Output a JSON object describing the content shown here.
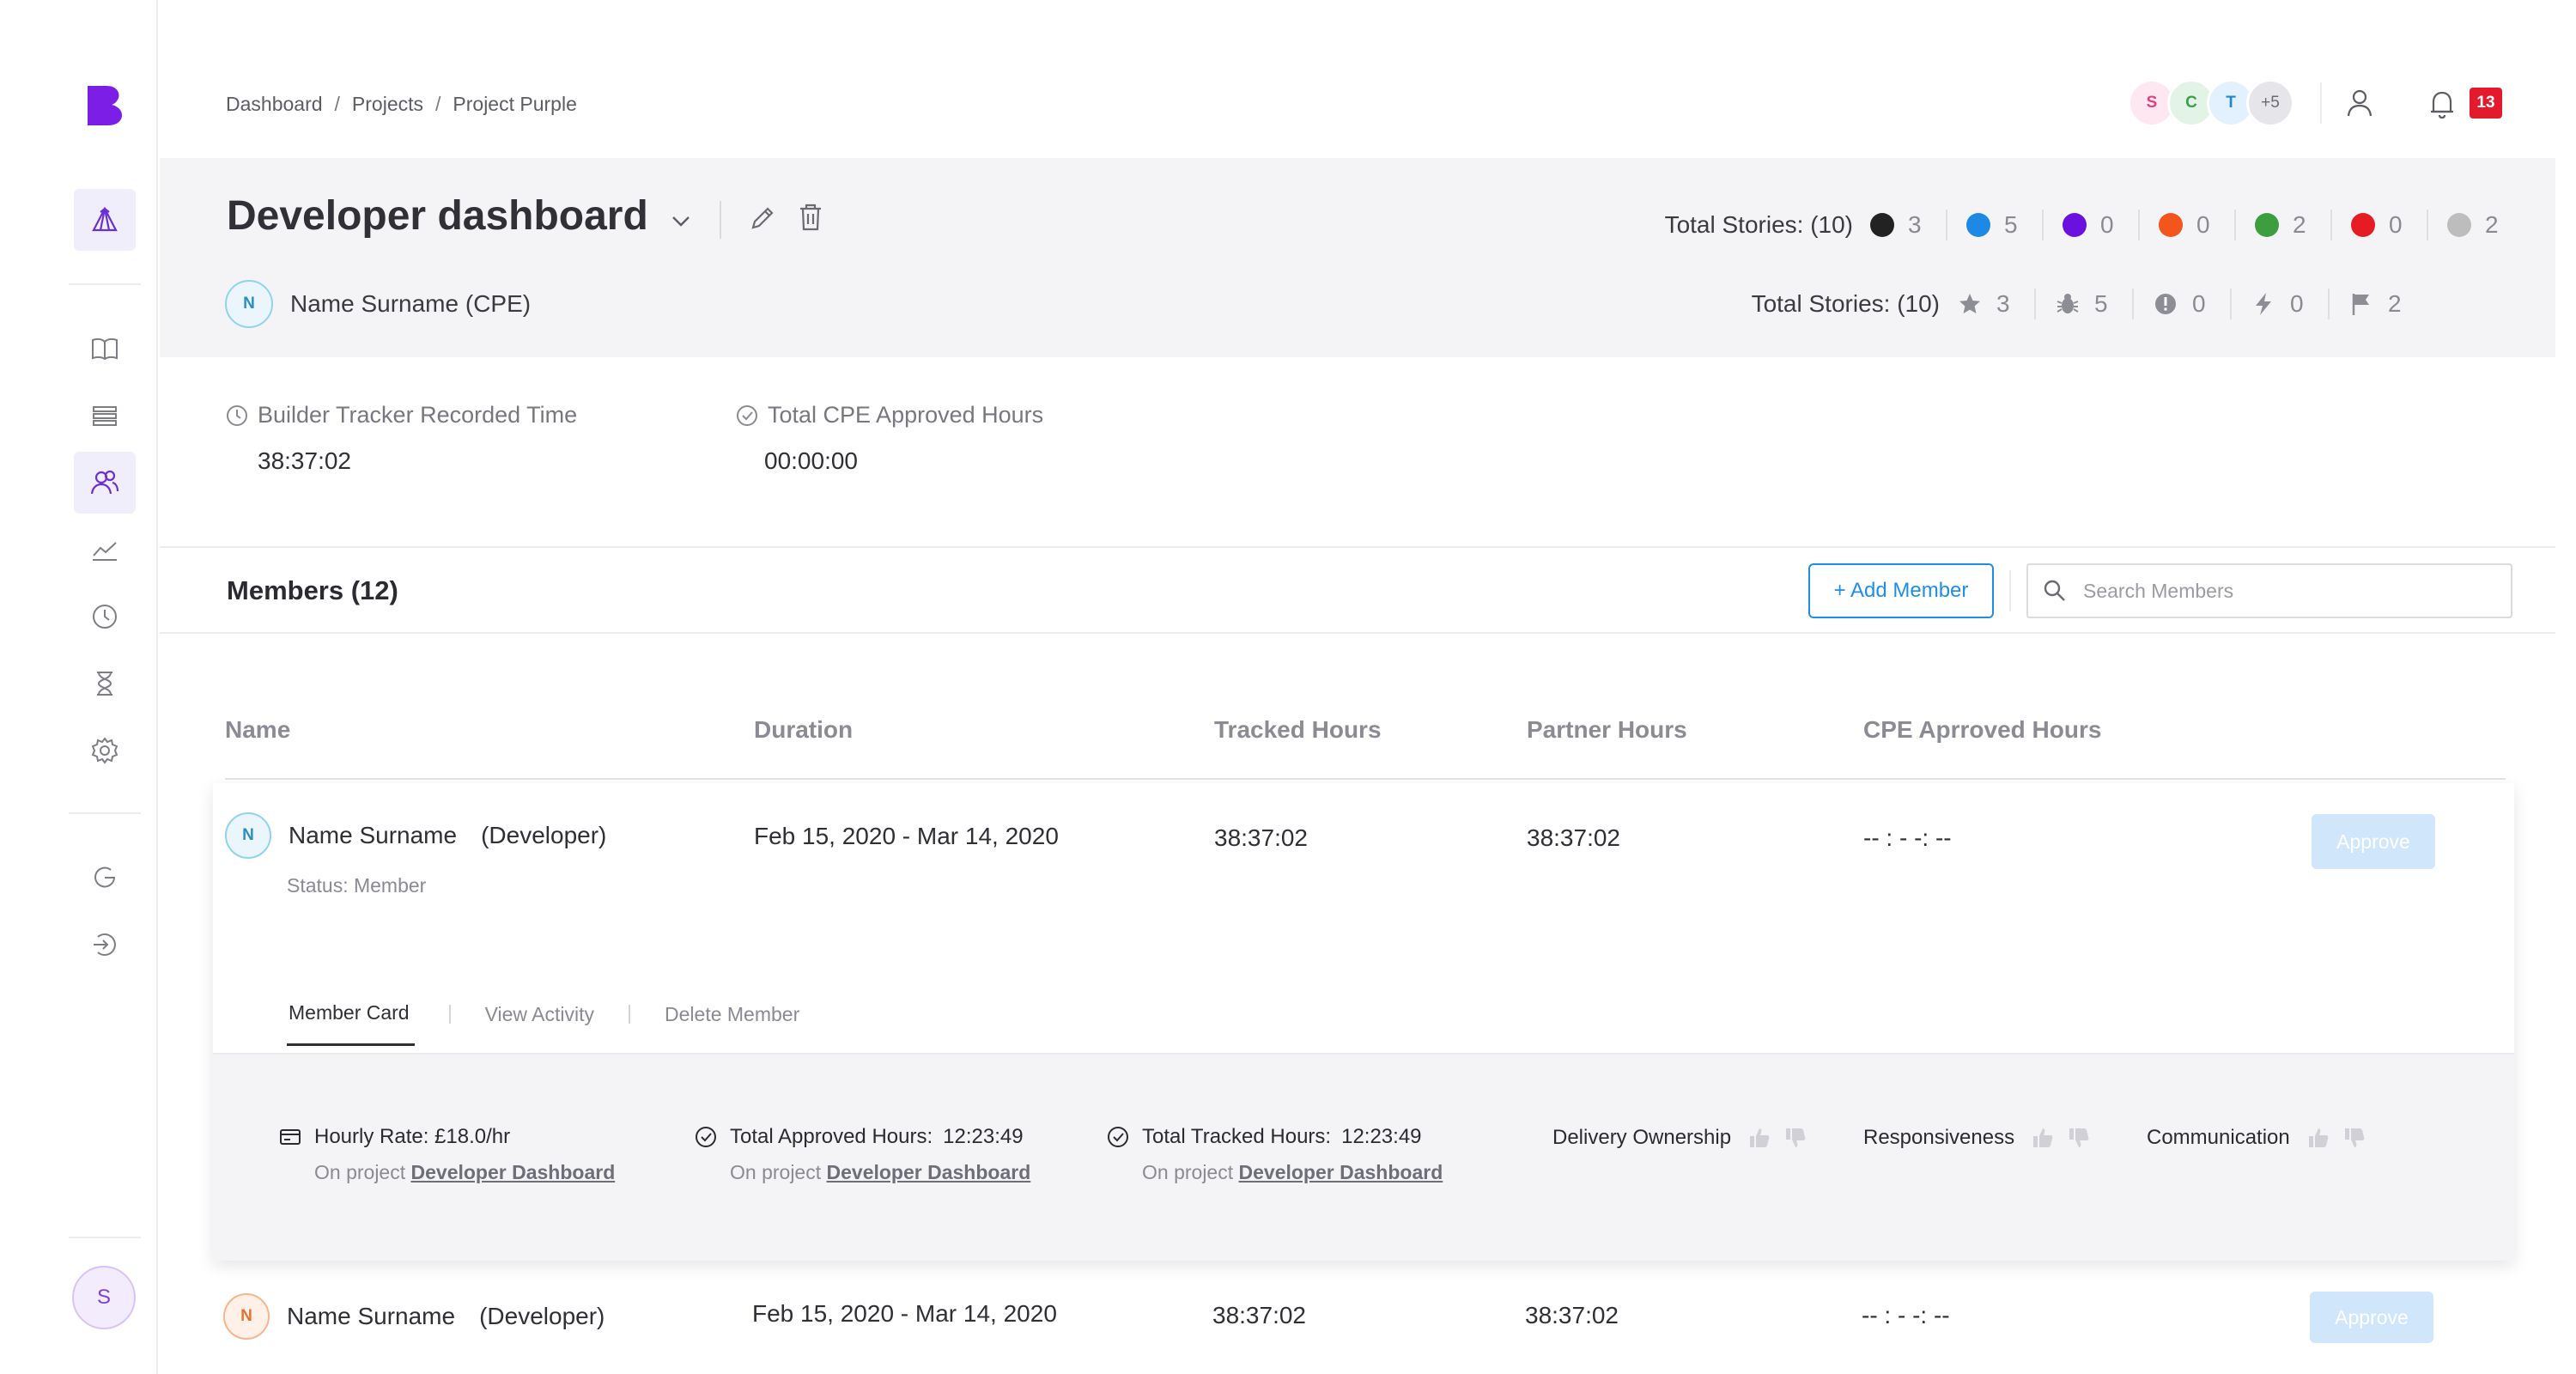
{
  "sidebar": {
    "logo": "builder-logo",
    "items": [
      {
        "icon": "tent-icon",
        "active": true
      },
      {
        "icon": "book-icon"
      },
      {
        "icon": "list-icon"
      },
      {
        "icon": "members-icon",
        "active": true
      },
      {
        "icon": "chart-icon"
      },
      {
        "icon": "clock-icon"
      },
      {
        "icon": "hourglass-icon"
      },
      {
        "icon": "gear-icon"
      },
      {
        "icon": "refresh-icon"
      },
      {
        "icon": "logout-icon"
      }
    ],
    "user_initial": "S"
  },
  "breadcrumb": [
    "Dashboard",
    "Projects",
    "Project Purple"
  ],
  "breadcrumb_sep": "/",
  "top_avatars": [
    {
      "initial": "S",
      "bg": "#fde7f1",
      "color": "#e0427f"
    },
    {
      "initial": "C",
      "bg": "#e3f4e6",
      "color": "#3aa04a"
    },
    {
      "initial": "T",
      "bg": "#e2f1fd",
      "color": "#2186d6"
    },
    {
      "initial": "+5",
      "bg": "#e6e6ea",
      "color": "#6a6a72"
    }
  ],
  "notifications": {
    "count": "13"
  },
  "header": {
    "title": "Developer dashboard",
    "owner_initial": "N",
    "owner_name": "Name Surname",
    "owner_role": "(CPE)",
    "stories_label": "Total Stories: (10)",
    "story_status_counts": [
      {
        "color": "#222222",
        "count": "3"
      },
      {
        "color": "#1e88e5",
        "count": "5"
      },
      {
        "color": "#6a11e0",
        "count": "0"
      },
      {
        "color": "#f2561d",
        "count": "0"
      },
      {
        "color": "#3d9d3f",
        "count": "2"
      },
      {
        "color": "#e51c23",
        "count": "0"
      },
      {
        "color": "#bdbdbd",
        "count": "2"
      }
    ],
    "story_type_counts": [
      {
        "icon": "star-icon",
        "count": "3"
      },
      {
        "icon": "bug-icon",
        "count": "5"
      },
      {
        "icon": "alert-icon",
        "count": "0"
      },
      {
        "icon": "lightning-icon",
        "count": "0"
      },
      {
        "icon": "flag-icon",
        "count": "2"
      }
    ]
  },
  "time": {
    "recorded_label": "Builder Tracker Recorded Time",
    "recorded_value": "38:37:02",
    "approved_label": "Total CPE Approved Hours",
    "approved_value": "00:00:00"
  },
  "members": {
    "title": "Members (12)",
    "add_label": "+ Add Member",
    "search_placeholder": "Search Members",
    "columns": [
      "Name",
      "Duration",
      "Tracked Hours",
      "Partner Hours",
      "CPE Aprroved Hours"
    ],
    "rows": [
      {
        "initial": "N",
        "name": "Name Surname",
        "role": "(Developer)",
        "status": "Status: Member",
        "duration": "Feb 15, 2020 - Mar 14, 2020",
        "tracked": "38:37:02",
        "partner": "38:37:02",
        "cpe": "-- : - -: --",
        "approve_label": "Approve"
      },
      {
        "initial": "N",
        "name": "Name Surname",
        "role": "(Developer)",
        "duration": "Feb 15, 2020 - Mar 14, 2020",
        "tracked": "38:37:02",
        "partner": "38:37:02",
        "cpe": "-- : - -: --",
        "approve_label": "Approve"
      }
    ],
    "tabs": [
      "Member Card",
      "View Activity",
      "Delete Member"
    ],
    "active_tab": "Member Card",
    "card": {
      "hourly_rate": "Hourly Rate: £18.0/hr",
      "approved_hours_label": "Total Approved Hours:",
      "approved_hours_value": "12:23:49",
      "tracked_hours_label": "Total Tracked Hours:",
      "tracked_hours_value": "12:23:49",
      "on_project_prefix": "On project",
      "project_link": "Developer Dashboard",
      "ratings": [
        "Delivery Ownership",
        "Responsiveness",
        "Communication"
      ]
    }
  }
}
